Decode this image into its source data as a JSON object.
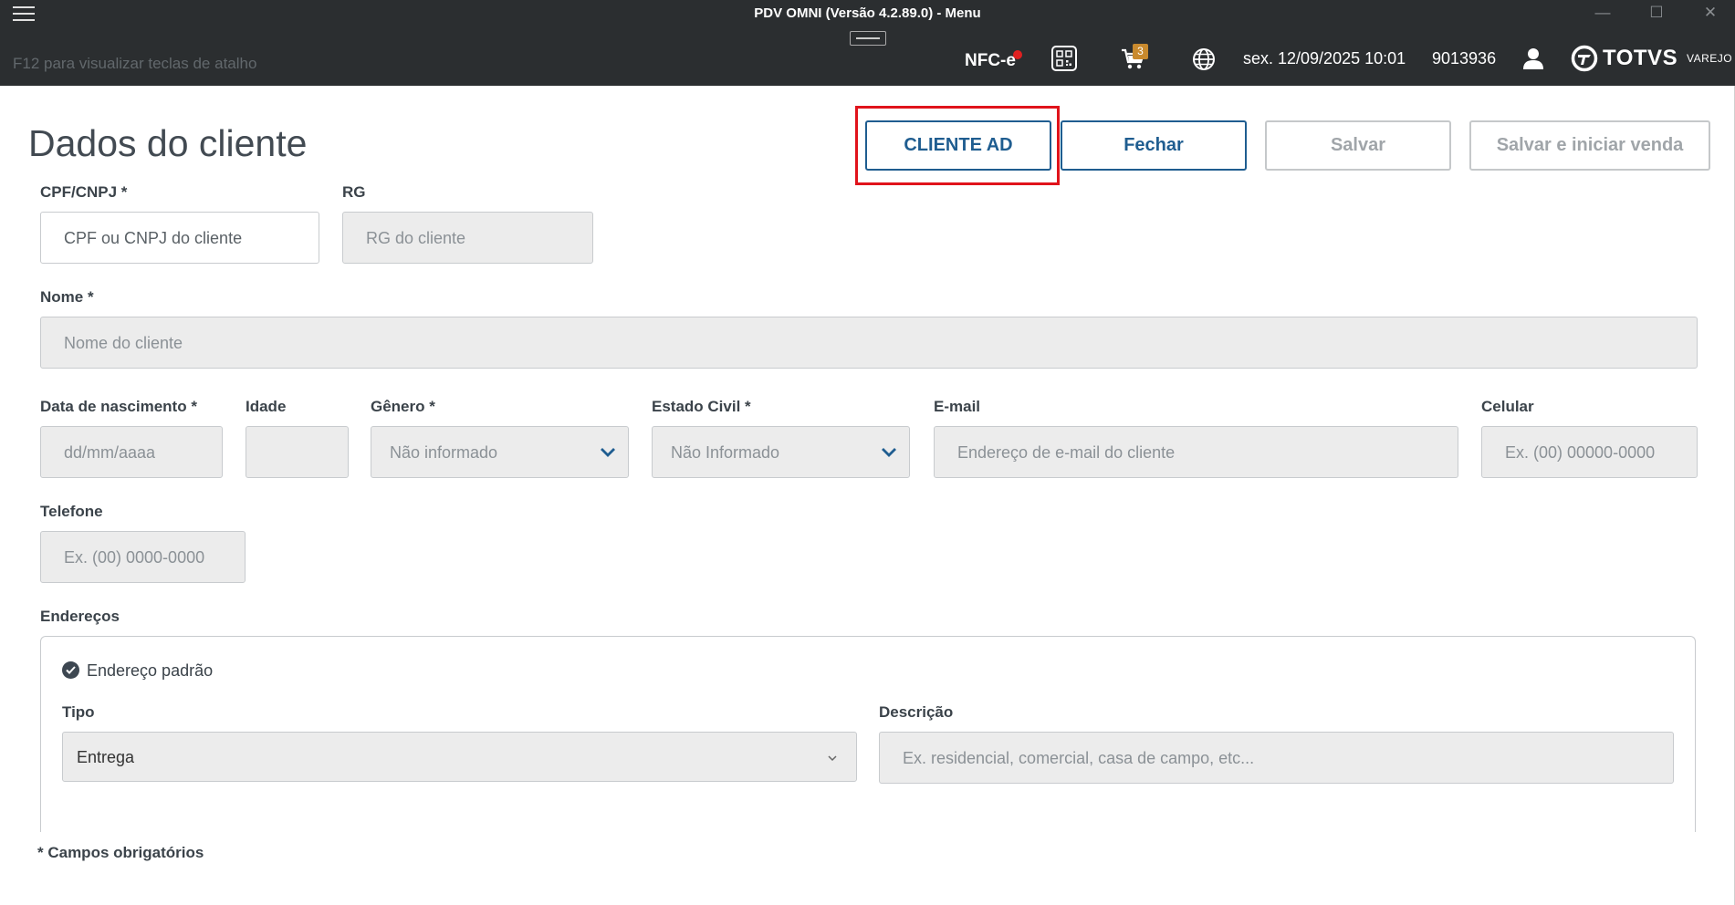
{
  "window": {
    "title": "PDV OMNI (Versão 4.2.89.0) - Menu",
    "minimize_glyph": "—",
    "maximize_glyph": "☐",
    "close_glyph": "✕"
  },
  "header": {
    "shortcut_hint": "F12 para visualizar teclas de atalho",
    "nfce_label": "NFC-e",
    "cart_count": "3",
    "datetime": "sex. 12/09/2025 10:01",
    "operator_id": "9013936",
    "brand_name": "TOTVS",
    "brand_sub": "VAREJO",
    "icons": [
      "menu-icon",
      "qr-code-icon",
      "cart-icon",
      "globe-icon",
      "user-icon",
      "totvs-logo-icon"
    ],
    "status_dot_color": "#e02020",
    "badge_color": "#c98a2e"
  },
  "page": {
    "title": "Dados do cliente"
  },
  "actions": {
    "cliente_ad": "CLIENTE AD",
    "fechar": "Fechar",
    "salvar": "Salvar",
    "salvar_iniciar": "Salvar e iniciar venda",
    "primary_color": "#1f5d90",
    "disabled_color": "#a0a5a9",
    "highlight_color": "#e0131b"
  },
  "form": {
    "cpf": {
      "label": "CPF/CNPJ  *",
      "placeholder": "CPF ou CNPJ do cliente"
    },
    "rg": {
      "label": "RG",
      "placeholder": "RG do cliente"
    },
    "nome": {
      "label": "Nome *",
      "placeholder": "Nome do cliente"
    },
    "nascimento": {
      "label": "Data de nascimento *",
      "placeholder": "dd/mm/aaaa"
    },
    "idade": {
      "label": "Idade",
      "value": ""
    },
    "genero": {
      "label": "Gênero *",
      "value": "Não informado"
    },
    "estado_civil": {
      "label": "Estado Civil *",
      "value": "Não Informado"
    },
    "email": {
      "label": "E-mail",
      "placeholder": "Endereço de e-mail do cliente"
    },
    "celular": {
      "label": "Celular",
      "placeholder": "Ex. (00) 00000-0000"
    },
    "telefone": {
      "label": "Telefone",
      "placeholder": "Ex. (00) 0000-0000"
    }
  },
  "addresses": {
    "section_label": "Endereços",
    "default_label": "Endereço padrão",
    "tipo_label": "Tipo",
    "tipo_value": "Entrega",
    "descricao_label": "Descrição",
    "descricao_placeholder": "Ex. residencial, comercial, casa de campo, etc..."
  },
  "footnote": "* Campos obrigatórios"
}
